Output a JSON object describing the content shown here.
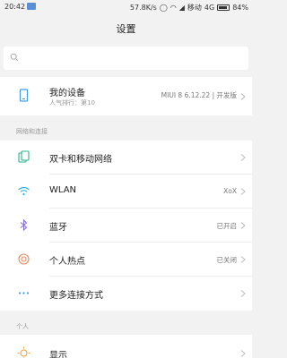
{
  "status": {
    "time": "20:42",
    "net_speed": "57.8K/s",
    "carrier": "移动",
    "network": "4G",
    "battery": "84%"
  },
  "title": "设置",
  "search": {
    "placeholder": ""
  },
  "device": {
    "title": "我的设备",
    "subtitle": "人气排行：第10",
    "version": "MIUI 8 6.12.22 | 开发版"
  },
  "sections": {
    "network": "网络和连接",
    "personal": "个人"
  },
  "network_items": [
    {
      "label": "双卡和移动网络",
      "value": "",
      "icon": "sim-card-icon"
    },
    {
      "label": "WLAN",
      "value": "XoX",
      "icon": "wifi-icon"
    },
    {
      "label": "蓝牙",
      "value": "已开启",
      "icon": "bluetooth-icon"
    },
    {
      "label": "个人热点",
      "value": "已关闭",
      "icon": "hotspot-icon"
    },
    {
      "label": "更多连接方式",
      "value": "",
      "icon": "more-dots-icon"
    }
  ],
  "personal_items": [
    {
      "label": "显示",
      "value": "",
      "icon": "display-sun-icon"
    }
  ],
  "colors": {
    "accent_blue": "#3f9ee8",
    "sim_green": "#27b38d",
    "wifi_cyan": "#2bb5e0",
    "bluetooth_purple": "#8a6fd8",
    "hotspot_orange": "#f0875a",
    "display_orange": "#f0a040"
  }
}
